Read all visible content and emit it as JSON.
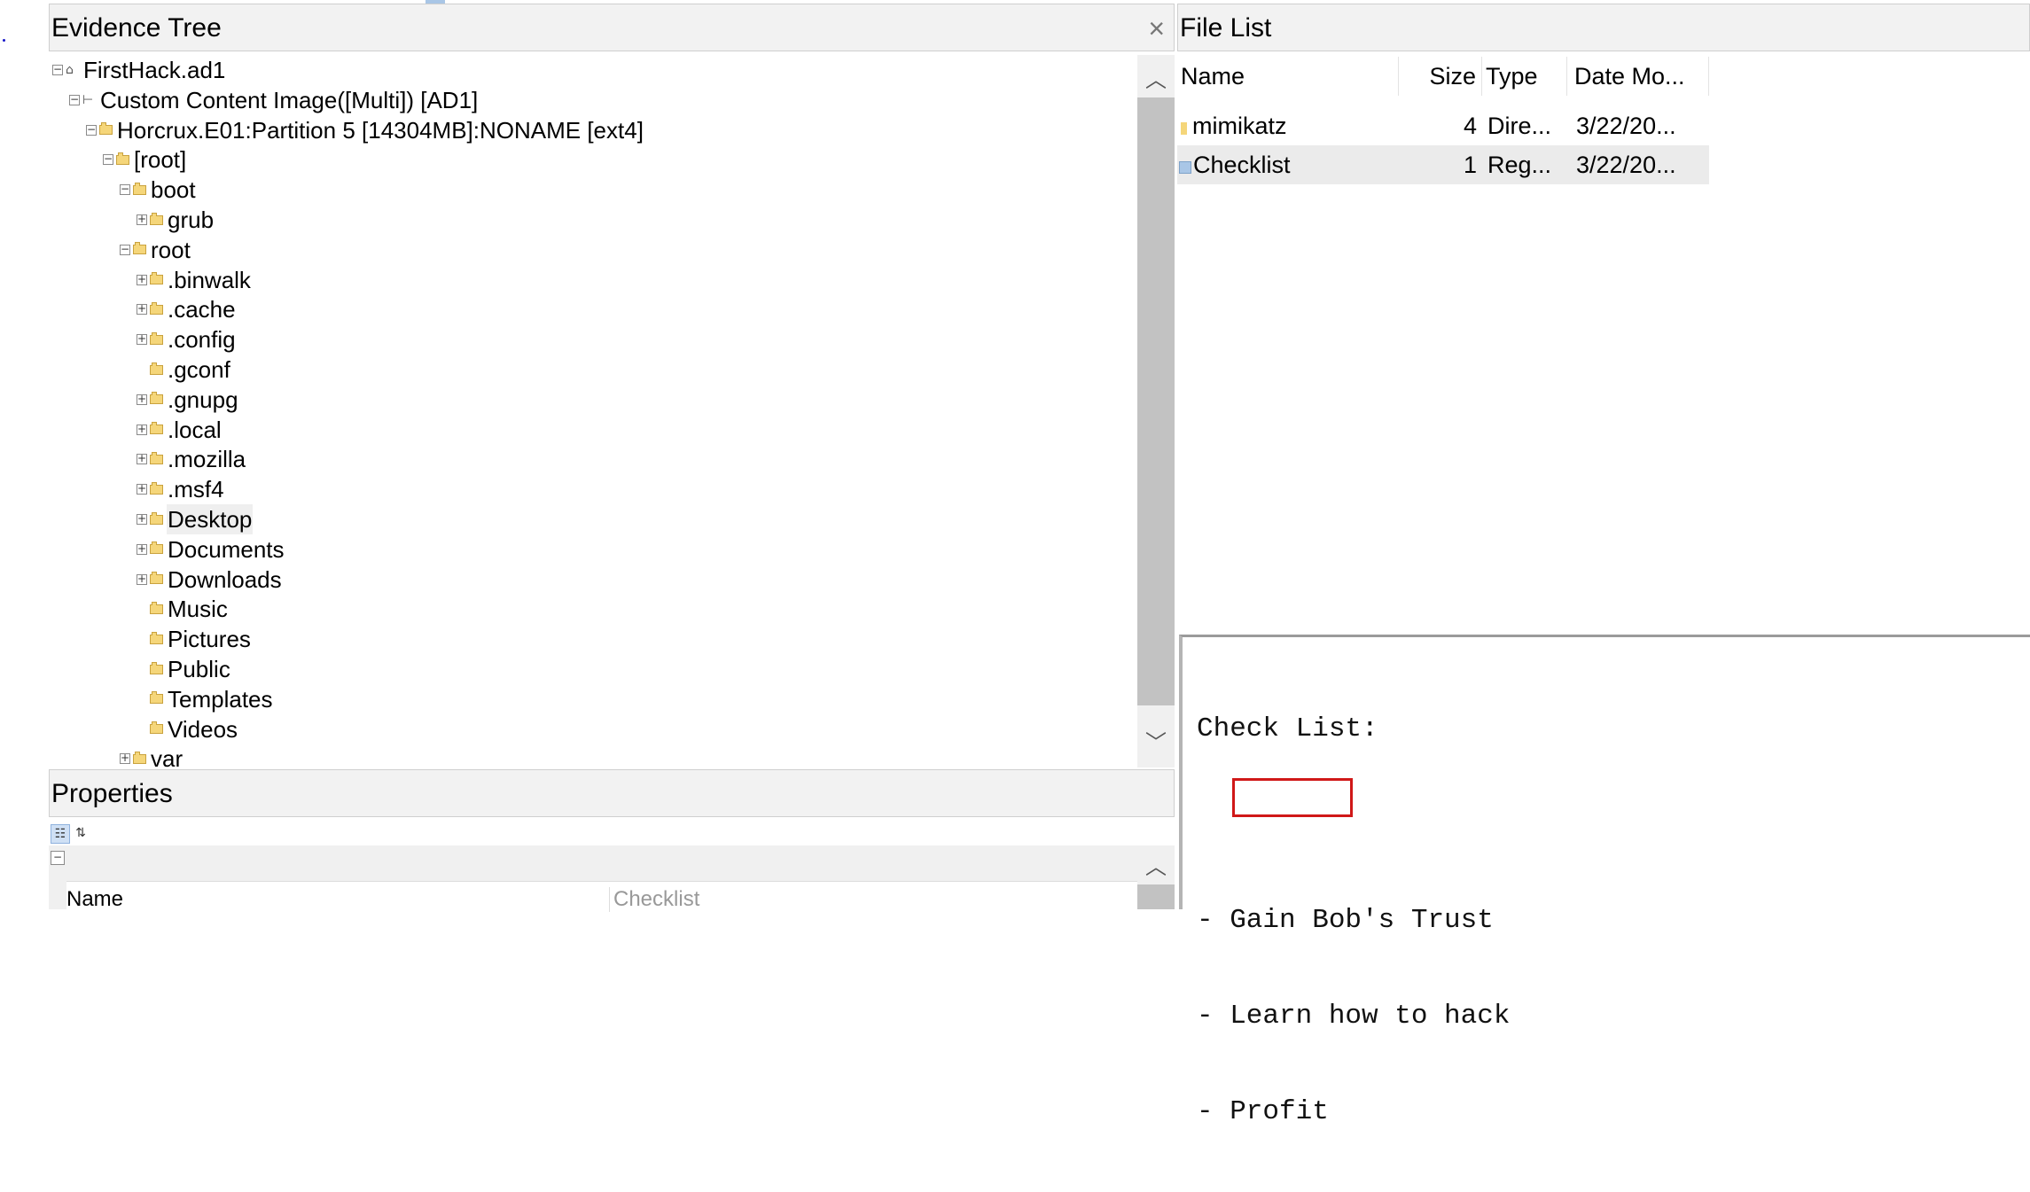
{
  "evidence_tree": {
    "title": "Evidence Tree",
    "close_label": "×",
    "nodes": [
      {
        "label": "FirstHack.ad1",
        "expander": "−",
        "icon": "evidence-icon"
      },
      {
        "label": "Custom Content Image([Multi]) [AD1]",
        "expander": "−",
        "icon": "image-tree-icon"
      },
      {
        "label": "Horcrux.E01:Partition 5 [14304MB]:NONAME [ext4]",
        "expander": "−",
        "icon": "folder-icon"
      },
      {
        "label": "[root]",
        "expander": "−",
        "icon": "folder-icon"
      },
      {
        "label": "boot",
        "expander": "−",
        "icon": "folder-icon"
      },
      {
        "label": "grub",
        "expander": "+",
        "icon": "folder-icon"
      },
      {
        "label": "root",
        "expander": "−",
        "icon": "folder-icon"
      },
      {
        "label": ".binwalk",
        "expander": "+",
        "icon": "folder-icon"
      },
      {
        "label": ".cache",
        "expander": "+",
        "icon": "folder-icon"
      },
      {
        "label": ".config",
        "expander": "+",
        "icon": "folder-icon"
      },
      {
        "label": ".gconf",
        "expander": "",
        "icon": "folder-icon"
      },
      {
        "label": ".gnupg",
        "expander": "+",
        "icon": "folder-icon"
      },
      {
        "label": ".local",
        "expander": "+",
        "icon": "folder-icon"
      },
      {
        "label": ".mozilla",
        "expander": "+",
        "icon": "folder-icon"
      },
      {
        "label": ".msf4",
        "expander": "+",
        "icon": "folder-icon"
      },
      {
        "label": "Desktop",
        "expander": "+",
        "icon": "folder-icon",
        "selected": true
      },
      {
        "label": "Documents",
        "expander": "+",
        "icon": "folder-icon"
      },
      {
        "label": "Downloads",
        "expander": "+",
        "icon": "folder-icon"
      },
      {
        "label": "Music",
        "expander": "",
        "icon": "folder-icon"
      },
      {
        "label": "Pictures",
        "expander": "",
        "icon": "folder-icon"
      },
      {
        "label": "Public",
        "expander": "",
        "icon": "folder-icon"
      },
      {
        "label": "Templates",
        "expander": "",
        "icon": "folder-icon"
      },
      {
        "label": "Videos",
        "expander": "",
        "icon": "folder-icon"
      },
      {
        "label": "var",
        "expander": "+",
        "icon": "folder-icon"
      }
    ]
  },
  "properties": {
    "title": "Properties",
    "name_header": "Name",
    "value": "Checklist"
  },
  "file_list": {
    "title": "File List",
    "columns": [
      "Name",
      "Size",
      "Type",
      "Date Mo..."
    ],
    "rows": [
      {
        "name": "mimikatz",
        "size": "4",
        "type": "Dire...",
        "date": "3/22/20...",
        "icon": "directory-icon"
      },
      {
        "name": "Checklist",
        "size": "1",
        "type": "Reg...",
        "date": "3/22/20...",
        "icon": "regular-file-icon",
        "selected": true
      }
    ]
  },
  "viewer": {
    "lines": [
      "Check List:",
      "",
      "- Gain Bob's Trust",
      "- Learn how to hack",
      "- Profit"
    ],
    "highlight_color": "#d01818"
  }
}
